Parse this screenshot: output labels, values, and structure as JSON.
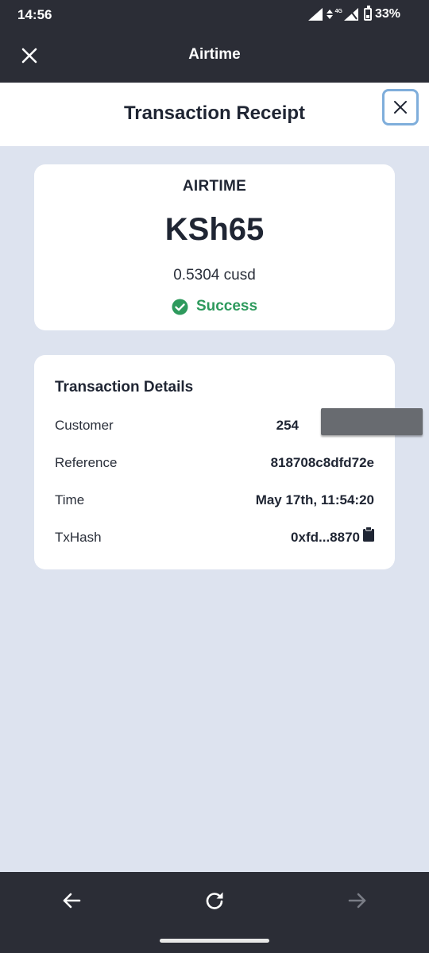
{
  "status_bar": {
    "time": "14:56",
    "network": "4G",
    "battery": "33%"
  },
  "app_bar": {
    "title": "Airtime",
    "close_icon": "close-icon"
  },
  "receipt": {
    "title": "Transaction Receipt",
    "summary": {
      "label": "AIRTIME",
      "amount": "KSh65",
      "crypto_amount": "0.5304 cusd",
      "status": "Success",
      "status_color": "#2e9a5d"
    },
    "details": {
      "title": "Transaction Details",
      "rows": [
        {
          "label": "Customer",
          "value": "254"
        },
        {
          "label": "Reference",
          "value": "818708c8dfd72e"
        },
        {
          "label": "Time",
          "value": "May 17th, 11:54:20"
        },
        {
          "label": "TxHash",
          "value": "0xfd...8870"
        }
      ]
    }
  },
  "nav": {
    "back_icon": "arrow-left-icon",
    "reload_icon": "reload-icon",
    "forward_icon": "arrow-right-icon"
  },
  "colors": {
    "bar": "#2b2d36",
    "page_bg": "#dde3ef",
    "accent_outline": "#7faedb"
  }
}
